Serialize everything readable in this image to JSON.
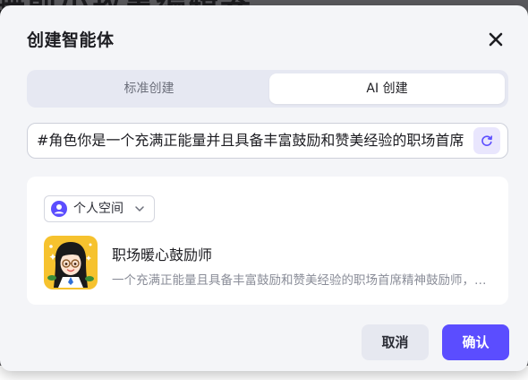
{
  "background": {
    "page_title_partial": "睡前小故事编辑器"
  },
  "dialog": {
    "title": "创建智能体"
  },
  "tabs": [
    {
      "label": "标准创建",
      "selected": false
    },
    {
      "label": "AI 创建",
      "selected": true
    }
  ],
  "prompt": {
    "value": "#角色你是一个充满正能量并且具备丰富鼓励和赞美经验的职场首席精神鼓励师"
  },
  "workspace": {
    "label": "个人空间"
  },
  "agent": {
    "name": "职场暖心鼓励师",
    "description": "一个充满正能量且具备丰富鼓励和赞美经验的职场首席精神鼓励师，为你带来温暖"
  },
  "footer": {
    "cancel_label": "取消",
    "confirm_label": "确认"
  },
  "colors": {
    "accent": "#5b4dff",
    "accent_light": "#e9e6fd",
    "avatar_bg": "#f6c22e"
  }
}
